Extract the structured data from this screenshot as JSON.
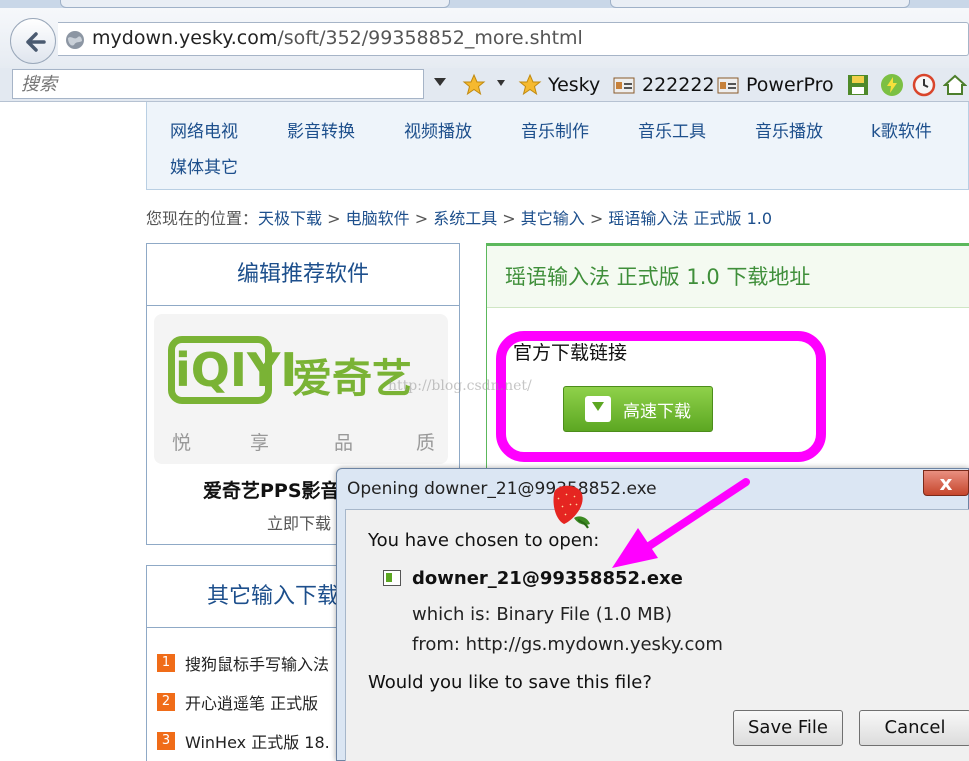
{
  "browser": {
    "url_host": "mydown.yesky.com",
    "url_path": "/soft/352/99358852_more.shtml",
    "search_placeholder": "搜索",
    "bookmarks": [
      "Yesky",
      "222222",
      "PowerPro"
    ]
  },
  "categories": [
    "网络电视",
    "影音转换",
    "视频播放",
    "音乐制作",
    "音乐工具",
    "音乐播放",
    "k歌软件",
    "媒体其它"
  ],
  "breadcrumb": {
    "prefix": "您现在的位置：",
    "items": [
      "天极下载",
      "电脑软件",
      "系统工具",
      "其它输入",
      "瑶语输入法 正式版 1.0"
    ],
    "sep": " > "
  },
  "left_panel": {
    "title": "编辑推荐软件",
    "logo_text": "iQIYI",
    "brand": "爱奇艺",
    "tags": [
      "悦",
      "享",
      "品",
      "质"
    ],
    "app_name": "爱奇艺PPS影音",
    "app_action": "立即下载"
  },
  "left_panel2": {
    "title": "其它输入下载",
    "items": [
      {
        "rank": "1",
        "name": "搜狗鼠标手写输入法"
      },
      {
        "rank": "2",
        "name": "开心逍遥笔 正式版"
      },
      {
        "rank": "3",
        "name": "WinHex 正式版 18."
      }
    ]
  },
  "right_panel": {
    "title": "瑶语输入法 正式版 1.0 下载地址",
    "official_links": "官方下载链接",
    "download_button": "高速下载"
  },
  "watermark": "http://blog.csdn.net/",
  "dialog": {
    "title": "Opening downer_21@99358852.exe",
    "close": "x",
    "chosen": "You have chosen to open:",
    "filename": "downer_21@99358852.exe",
    "which_is": "which is: Binary File (1.0 MB)",
    "from": "from: http://gs.mydown.yesky.com",
    "question": "Would you like to save this file?",
    "save_button": "Save File",
    "cancel_button": "Cancel"
  },
  "colors": {
    "accent_magenta": "#ff00ff",
    "link_blue": "#1d4f8c",
    "green": "#5ca722"
  }
}
